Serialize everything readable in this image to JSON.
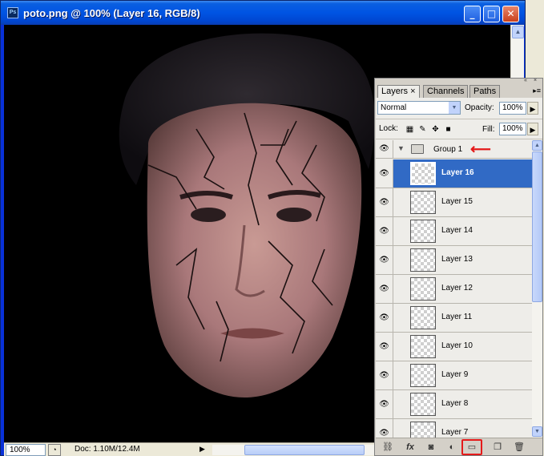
{
  "window": {
    "title": "poto.png @ 100% (Layer 16, RGB/8)",
    "app_icon_label": "Ps",
    "buttons": [
      "minimize",
      "maximize",
      "close"
    ]
  },
  "status_bar": {
    "zoom": "100%",
    "doc_info": "Doc: 1.10M/12.4M"
  },
  "panel": {
    "tabs": [
      "Layers",
      "Channels",
      "Paths"
    ],
    "active_tab": "Layers",
    "blend_mode": "Normal",
    "opacity_label": "Opacity:",
    "opacity_value": "100%",
    "lock_label": "Lock:",
    "fill_label": "Fill:",
    "fill_value": "100%",
    "group_name": "Group 1",
    "selected_layer": "Layer 16",
    "layers": [
      {
        "name": "Layer 16"
      },
      {
        "name": "Layer 15"
      },
      {
        "name": "Layer 14"
      },
      {
        "name": "Layer 13"
      },
      {
        "name": "Layer 12"
      },
      {
        "name": "Layer 11"
      },
      {
        "name": "Layer 10"
      },
      {
        "name": "Layer 9"
      },
      {
        "name": "Layer 8"
      },
      {
        "name": "Layer 7"
      }
    ],
    "toolbar_icons": [
      "link-icon",
      "fx-icon",
      "mask-icon",
      "adjustment-icon",
      "new-group-icon",
      "new-layer-icon",
      "trash-icon"
    ]
  },
  "colors": {
    "title_blue": "#0054e3",
    "selection_blue": "#316ac5",
    "annotation_red": "#e41a1a"
  }
}
